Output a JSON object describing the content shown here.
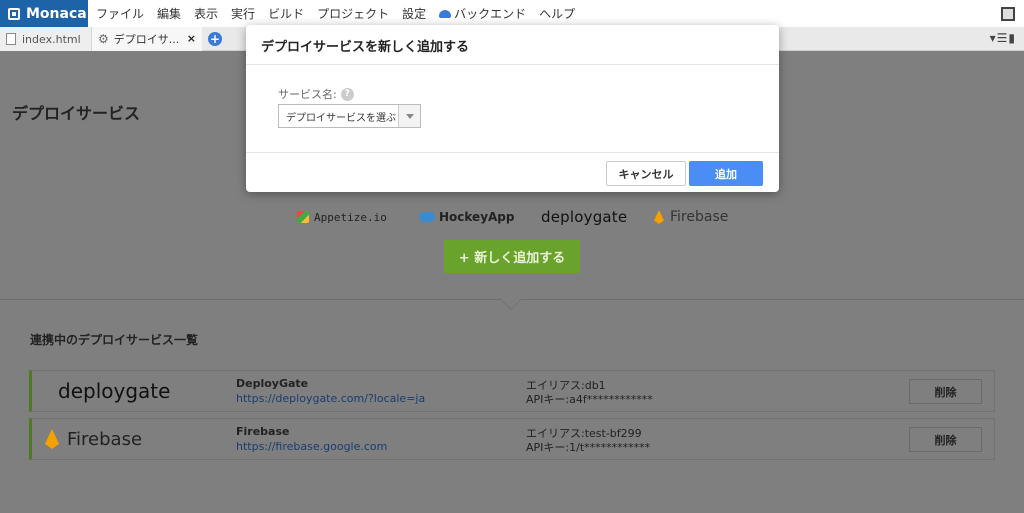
{
  "app": {
    "name": "Monaca"
  },
  "menu": {
    "items": [
      "ファイル",
      "編集",
      "表示",
      "実行",
      "ビルド",
      "プロジェクト",
      "設定",
      "バックエンド",
      "ヘルプ"
    ]
  },
  "tabs": [
    {
      "label": "index.html",
      "icon": "file-icon"
    },
    {
      "label": "デプロイサ...",
      "icon": "gear-icon",
      "close": "×"
    }
  ],
  "page": {
    "heading": "デプロイサービス",
    "services": [
      "Appetize.io",
      "HockeyApp",
      "deploygate",
      "Firebase"
    ],
    "add_button": "+ 新しく追加する",
    "list_heading": "連携中のデプロイサービス一覧",
    "connected": [
      {
        "logo": "deploygate",
        "name": "DeployGate",
        "url": "https://deploygate.com/?locale=ja",
        "alias": "エイリアス:db1",
        "api_key": "APIキー:a4f************",
        "delete_label": "削除"
      },
      {
        "logo": "Firebase",
        "name": "Firebase",
        "url": "https://firebase.google.com",
        "alias": "エイリアス:test-bf299",
        "api_key": "APIキー:1/t************",
        "delete_label": "削除"
      }
    ]
  },
  "modal": {
    "title": "デプロイサービスを新しく追加する",
    "field_label": "サービス名:",
    "help": "?",
    "select_value": "デプロイサービスを選ぶ",
    "cancel_label": "キャンセル",
    "confirm_label": "追加"
  },
  "colors": {
    "brand": "#1d63a8",
    "accent_green": "#6aa32c",
    "primary_blue": "#4a8df5",
    "overlay": "#7f7f7f"
  }
}
